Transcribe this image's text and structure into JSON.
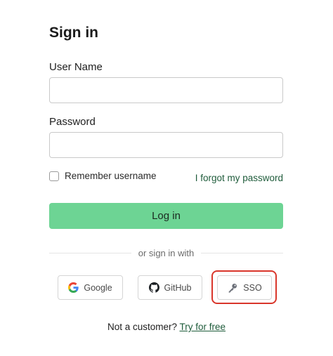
{
  "title": "Sign in",
  "username": {
    "label": "User Name",
    "value": "",
    "placeholder": ""
  },
  "password": {
    "label": "Password",
    "value": "",
    "placeholder": ""
  },
  "remember": {
    "label": "Remember username",
    "checked": false
  },
  "forgot_link": "I forgot my password",
  "login_button": "Log in",
  "divider_text": "or sign in with",
  "providers": {
    "google": {
      "label": "Google",
      "icon": "google-icon"
    },
    "github": {
      "label": "GitHub",
      "icon": "github-icon"
    },
    "sso": {
      "label": "SSO",
      "icon": "key-icon"
    }
  },
  "footer": {
    "prompt": "Not a customer?",
    "link": "Try for free"
  },
  "colors": {
    "primary_button": "#6dd494",
    "link": "#1f5c3b",
    "highlight": "#d9362b"
  }
}
